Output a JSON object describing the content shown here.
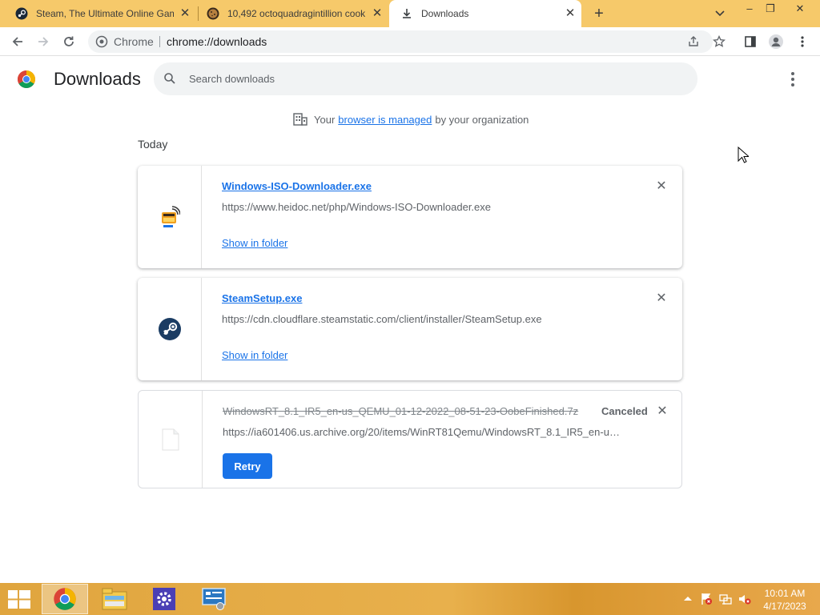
{
  "browser": {
    "tabs": [
      {
        "title": "Steam, The Ultimate Online Gam",
        "icon": "steam-icon"
      },
      {
        "title": "10,492 octoquadragintillion cook",
        "icon": "cookie-icon"
      },
      {
        "title": "Downloads",
        "icon": "download-icon"
      }
    ],
    "new_tab_label": "+",
    "omnibox": {
      "scheme_label": "Chrome",
      "url": "chrome://downloads"
    }
  },
  "downloads": {
    "title": "Downloads",
    "search_placeholder": "Search downloads",
    "managed": {
      "prefix": "Your",
      "link": "browser is managed",
      "suffix": "by your organization"
    },
    "date_header": "Today",
    "items": [
      {
        "filename": "Windows-ISO-Downloader.exe",
        "url": "https://www.heidoc.net/php/Windows-ISO-Downloader.exe",
        "action_label": "Show in folder",
        "icon": "heidoc-app-icon"
      },
      {
        "filename": "SteamSetup.exe",
        "url": "https://cdn.cloudflare.steamstatic.com/client/installer/SteamSetup.exe",
        "action_label": "Show in folder",
        "icon": "steam-icon"
      },
      {
        "filename": "WindowsRT_8.1_IR5_en-us_QEMU_01-12-2022_08-51-23-OobeFinished.7z",
        "url": "https://ia601406.us.archive.org/20/items/WinRT81Qemu/WindowsRT_8.1_IR5_en-us...",
        "status": "Canceled",
        "retry_label": "Retry",
        "icon": "file-icon"
      }
    ]
  },
  "taskbar": {
    "apps": [
      "chrome-icon",
      "file-explorer-icon",
      "settings-icon",
      "control-panel-icon"
    ],
    "clock": {
      "time": "10:01 AM",
      "date": "4/17/2023"
    }
  },
  "colors": {
    "tabstrip": "#f6c96a",
    "link": "#1a73e8",
    "taskbar": "#e0a53e"
  }
}
